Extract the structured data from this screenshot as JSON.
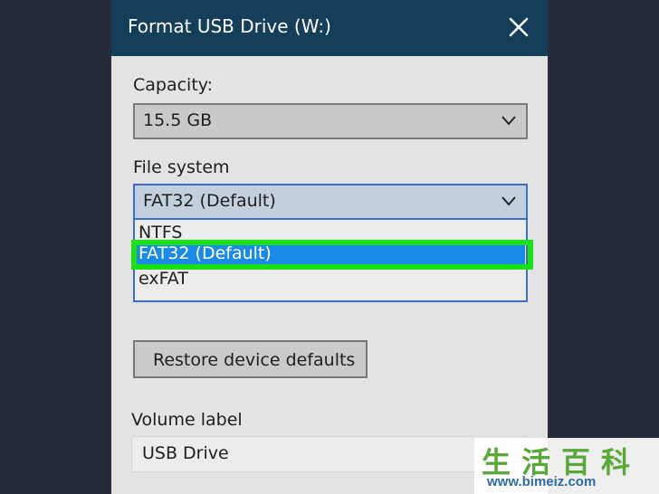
{
  "dialog": {
    "title": "Format USB Drive (W:)",
    "close_icon": "close-icon"
  },
  "capacity": {
    "label": "Capacity:",
    "value": "15.5 GB"
  },
  "file_system": {
    "label": "File system",
    "value": "FAT32 (Default)",
    "options": [
      "NTFS",
      "FAT32 (Default)",
      "exFAT"
    ],
    "selected_index": 1
  },
  "restore_button": {
    "label": "Restore device defaults"
  },
  "volume_label": {
    "label": "Volume label",
    "value": "USB Drive"
  },
  "watermark": {
    "chars": "生活百科",
    "url": "www.bimeiz.com"
  },
  "colors": {
    "titlebar": "#143e5a",
    "dialog_bg": "#e3e3e3",
    "highlight_green": "#19e316",
    "selected_blue": "#1a8ae6",
    "desktop_bg": "#272c3a"
  }
}
